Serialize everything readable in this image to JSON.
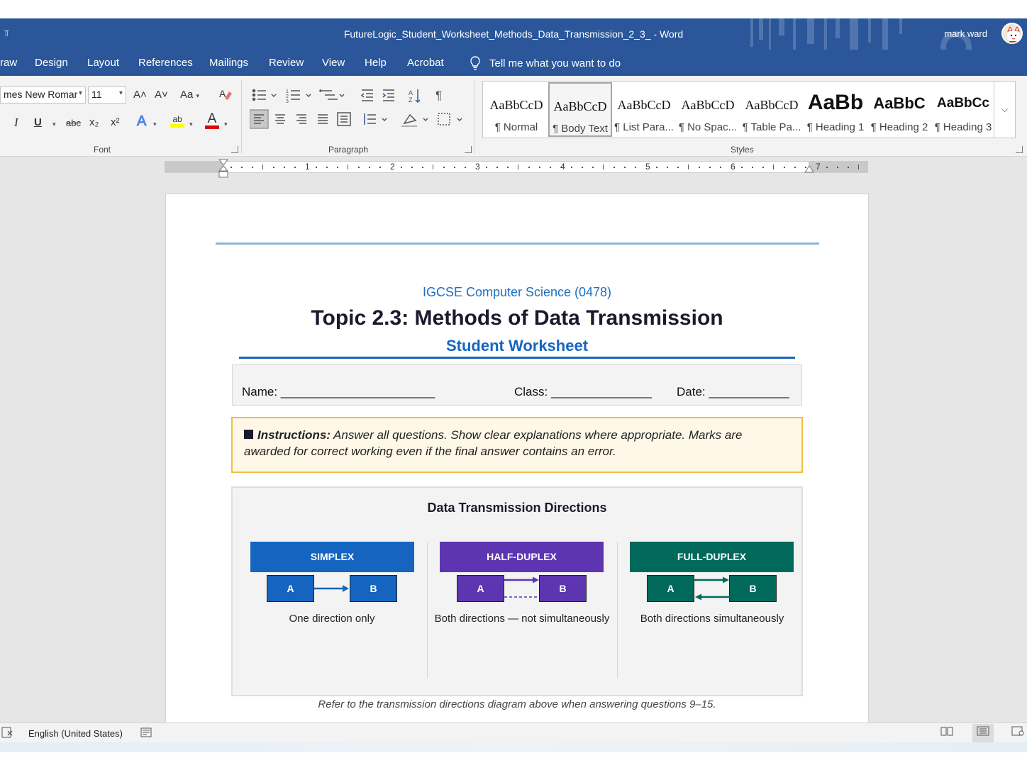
{
  "titlebar": {
    "document_title": "FutureLogic_Student_Worksheet_Methods_Data_Transmission_2_3_  -  Word",
    "user_name": "mark ward",
    "qat_glyph": "⫪"
  },
  "menu": {
    "tabs": [
      "raw",
      "Design",
      "Layout",
      "References",
      "Mailings",
      "Review",
      "View",
      "Help",
      "Acrobat"
    ],
    "tell_me": "Tell me what you want to do"
  },
  "ribbon": {
    "font": {
      "group_label": "Font",
      "font_name": "mes New Romar",
      "font_size": "11",
      "grow": "A˄",
      "shrink": "A˅",
      "change_case": "Aa",
      "italic": "I",
      "underline": "U",
      "strikethrough": "abc",
      "subscript": "x₂",
      "superscript": "x²",
      "text_effects": "A",
      "highlight": "ab",
      "font_color": "A"
    },
    "paragraph": {
      "group_label": "Paragraph"
    },
    "styles": {
      "group_label": "Styles",
      "items": [
        {
          "preview": "AaBbCcD",
          "name": "¶ Normal"
        },
        {
          "preview": "AaBbCcD",
          "name": "¶ Body Text",
          "selected": true
        },
        {
          "preview": "AaBbCcD",
          "name": "¶ List Para..."
        },
        {
          "preview": "AaBbCcD",
          "name": "¶ No Spac..."
        },
        {
          "preview": "AaBbCcD",
          "name": "¶ Table Pa..."
        },
        {
          "preview": "AaBb",
          "name": "¶ Heading 1"
        },
        {
          "preview": "AaBbC",
          "name": "¶ Heading 2"
        },
        {
          "preview": "AaBbCc",
          "name": "¶ Heading 3"
        }
      ]
    }
  },
  "ruler": {
    "numbers": [
      "1",
      "2",
      "3",
      "4",
      "5",
      "6",
      "7"
    ]
  },
  "document": {
    "course": "IGCSE Computer Science (0478)",
    "topic": "Topic 2.3: Methods of Data Transmission",
    "subtitle": "Student Worksheet",
    "fields": {
      "name": "Name: _______________________",
      "class": "Class: _______________",
      "date": "Date: ____________"
    },
    "instructions": {
      "label": "Instructions:",
      "text": " Answer all questions. Show clear explanations where appropriate. Marks are awarded for correct working even if the final answer contains an error."
    },
    "diagram": {
      "title": "Data Transmission Directions",
      "modes": [
        {
          "header": "SIMPLEX",
          "node_a": "A",
          "node_b": "B",
          "description": "One direction only",
          "color": "#1565c0"
        },
        {
          "header": "HALF-DUPLEX",
          "node_a": "A",
          "node_b": "B",
          "description": "Both directions — not simultaneously",
          "color": "#5e35b1"
        },
        {
          "header": "FULL-DUPLEX",
          "node_a": "A",
          "node_b": "B",
          "description": "Both directions simultaneously",
          "color": "#00695c"
        }
      ]
    },
    "caption": "Refer to the transmission directions diagram above when answering questions 9–15."
  },
  "statusbar": {
    "language": "English (United States)"
  },
  "colors": {
    "word_blue": "#2b579a",
    "title_blue": "#1565c0",
    "instr_border": "#f0c040"
  }
}
